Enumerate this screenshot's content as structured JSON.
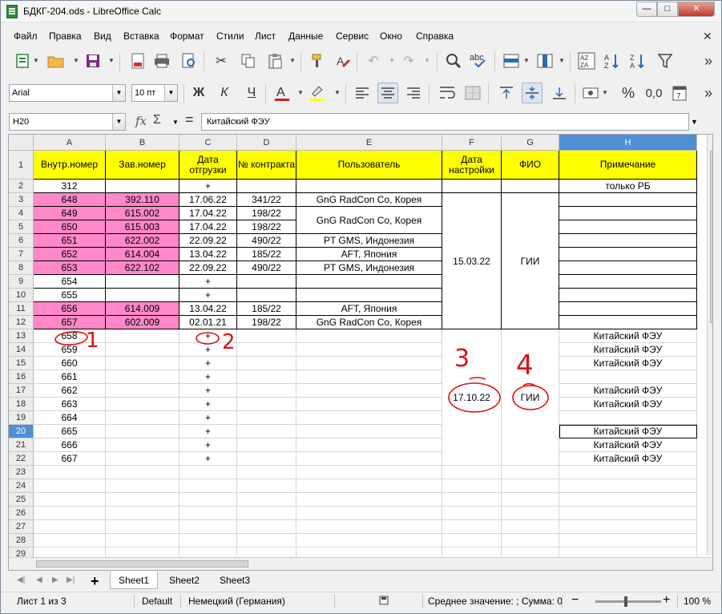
{
  "window": {
    "title": "БДКГ-204.ods - LibreOffice Calc",
    "minimize": "—",
    "maximize": "□",
    "close": "✕"
  },
  "menu": [
    "Файл",
    "Правка",
    "Вид",
    "Вставка",
    "Формат",
    "Стили",
    "Лист",
    "Данные",
    "Сервис",
    "Окно",
    "Справка"
  ],
  "toolbar": {
    "font_name": "Arial",
    "font_size": "10 пт",
    "bold": "Ж",
    "italic": "К",
    "underline": "Ч",
    "percent": "%",
    "decimal": "0,0"
  },
  "formula_bar": {
    "cell_ref": "H20",
    "fx": "fx",
    "sigma": "Σ",
    "equals": "=",
    "content": "Китайский ФЭУ"
  },
  "grid": {
    "columns": [
      "A",
      "B",
      "C",
      "D",
      "E",
      "F",
      "G",
      "H"
    ],
    "header": [
      "Внутр.номер",
      "Зав.номер",
      "Дата отгрузки",
      "№ контракта",
      "Пользователь",
      "Дата настройки",
      "ФИО",
      "Примечание"
    ],
    "rows": [
      {
        "n": "2",
        "a": "312",
        "b": "",
        "c": "+",
        "d": "",
        "h": "только РБ"
      },
      {
        "n": "3",
        "a": "648",
        "b": "392.110",
        "c": "17.06.22",
        "d": "341/22",
        "h": ""
      },
      {
        "n": "4",
        "a": "649",
        "b": "615.002",
        "c": "17.04.22",
        "d": "198/22",
        "h": ""
      },
      {
        "n": "5",
        "a": "650",
        "b": "615.003",
        "c": "17.04.22",
        "d": "198/22",
        "h": ""
      },
      {
        "n": "6",
        "a": "651",
        "b": "622.002",
        "c": "22.09.22",
        "d": "490/22",
        "h": ""
      },
      {
        "n": "7",
        "a": "652",
        "b": "614.004",
        "c": "13.04.22",
        "d": "185/22",
        "h": ""
      },
      {
        "n": "8",
        "a": "653",
        "b": "622.102",
        "c": "22.09.22",
        "d": "490/22",
        "h": ""
      },
      {
        "n": "9",
        "a": "654",
        "b": "",
        "c": "+",
        "d": "",
        "h": ""
      },
      {
        "n": "10",
        "a": "655",
        "b": "",
        "c": "+",
        "d": "",
        "h": ""
      },
      {
        "n": "11",
        "a": "656",
        "b": "614.009",
        "c": "13.04.22",
        "d": "185/22",
        "h": ""
      },
      {
        "n": "12",
        "a": "657",
        "b": "602.009",
        "c": "02.01.21",
        "d": "198/22",
        "h": ""
      },
      {
        "n": "13",
        "a": "658",
        "b": "",
        "c": "+",
        "d": "",
        "h": "Китайский ФЭУ"
      },
      {
        "n": "14",
        "a": "659",
        "b": "",
        "c": "+",
        "d": "",
        "h": "Китайский ФЭУ"
      },
      {
        "n": "15",
        "a": "660",
        "b": "",
        "c": "+",
        "d": "",
        "h": "Китайский ФЭУ"
      },
      {
        "n": "16",
        "a": "661",
        "b": "",
        "c": "+",
        "d": "",
        "h": ""
      },
      {
        "n": "17",
        "a": "662",
        "b": "",
        "c": "+",
        "d": "",
        "h": "Китайский ФЭУ"
      },
      {
        "n": "18",
        "a": "663",
        "b": "",
        "c": "+",
        "d": "",
        "h": "Китайский ФЭУ"
      },
      {
        "n": "19",
        "a": "664",
        "b": "",
        "c": "+",
        "d": "",
        "h": ""
      },
      {
        "n": "20",
        "a": "665",
        "b": "",
        "c": "+",
        "d": "",
        "h": "Китайский ФЭУ"
      },
      {
        "n": "21",
        "a": "666",
        "b": "",
        "c": "+",
        "d": "",
        "h": "Китайский ФЭУ"
      },
      {
        "n": "22",
        "a": "667",
        "b": "",
        "c": "+",
        "d": "",
        "h": "Китайский ФЭУ"
      },
      {
        "n": "23",
        "a": "",
        "b": "",
        "c": "",
        "d": "",
        "h": ""
      },
      {
        "n": "24",
        "a": "",
        "b": "",
        "c": "",
        "d": "",
        "h": ""
      },
      {
        "n": "25",
        "a": "",
        "b": "",
        "c": "",
        "d": "",
        "h": ""
      },
      {
        "n": "26",
        "a": "",
        "b": "",
        "c": "",
        "d": "",
        "h": ""
      },
      {
        "n": "27",
        "a": "",
        "b": "",
        "c": "",
        "d": "",
        "h": ""
      },
      {
        "n": "28",
        "a": "",
        "b": "",
        "c": "",
        "d": "",
        "h": ""
      },
      {
        "n": "29",
        "a": "",
        "b": "",
        "c": "",
        "d": "",
        "h": ""
      }
    ],
    "users": [
      "GnG RadCon Co, Корея",
      "GnG RadCon Co, Корея",
      "PT GMS, Индонезия",
      "AFT, Япония",
      "PT GMS, Индонезия",
      "AFT, Япония",
      "GnG RadCon Co, Корея"
    ],
    "merged_f1": "15.03.22",
    "merged_g1": "ГИИ",
    "merged_f2": "17.10.22",
    "merged_g2": "ГИИ",
    "pink_rows": [
      "3",
      "4",
      "5",
      "6",
      "7",
      "8",
      "11",
      "12"
    ],
    "selected_row": "20",
    "selected_col": "H"
  },
  "annotations": [
    "1",
    "2",
    "3",
    "4"
  ],
  "tabs": [
    "Sheet1",
    "Sheet2",
    "Sheet3"
  ],
  "status": {
    "sheet": "Лист 1 из 3",
    "style": "Default",
    "language": "Немецкий (Германия)",
    "summary": "Среднее значение: ; Сумма: 0",
    "zoom": "100 %",
    "minus": "−",
    "plus": "+"
  },
  "colors": {
    "header_yellow": "#ffff00",
    "pink": "#ff88c8",
    "annot_red": "#e01010",
    "selection": "#4f8fd5"
  }
}
